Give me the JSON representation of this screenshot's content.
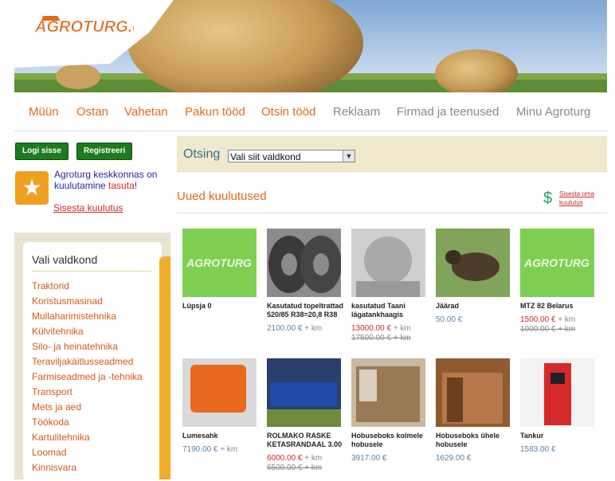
{
  "logo": "AGROTURG.ee",
  "nav": [
    {
      "label": "Müün"
    },
    {
      "label": "Ostan"
    },
    {
      "label": "Vahetan"
    },
    {
      "label": "Pakun tööd"
    },
    {
      "label": "Otsin tööd"
    },
    {
      "label": "Reklaam"
    },
    {
      "label": "Firmad ja teenused"
    },
    {
      "label": "Minu Agroturg"
    }
  ],
  "auth": {
    "login": "Logi sisse",
    "register": "Registreeri"
  },
  "promo": {
    "text": "Agroturg keskkonnas on kuulutamine ",
    "accent": "tasuta",
    "end": "!",
    "link": "Sisesta kuulutus"
  },
  "sidebar": {
    "title": "Vali valdkond",
    "items": [
      "Traktorid",
      "Koristusmasinad",
      "Mullaharimistehnika",
      "Külvitehnika",
      "Silo- ja heinatehnika",
      "Teraviljakäitlusseadmed",
      "Farmiseadmed ja -tehnika",
      "Transport",
      "Mets ja aed",
      "Töökoda",
      "Kartulitehnika",
      "Loomad",
      "Kinnisvara"
    ]
  },
  "search": {
    "label": "Otsing",
    "select": "Vali siit valdkond"
  },
  "listings": {
    "title": "Uued kuulutused",
    "post_link": "Sisesta oma kuulutus",
    "items": [
      {
        "title": "Lüpsja 0",
        "price": "",
        "km": "",
        "old": ""
      },
      {
        "title": "Kasutatud topeltrattad 520/85 R38=20,8 R38",
        "price": "2100.00 €",
        "km": " + km",
        "old": ""
      },
      {
        "title": "kasutatud Taani lägatankhaagis",
        "price": "13000.00 €",
        "km": " + km",
        "old": "17500.00 € + km"
      },
      {
        "title": "Jäärad",
        "price": "50.00 €",
        "km": "",
        "old": ""
      },
      {
        "title": "MTZ 82 Belarus",
        "price": "1500.00 €",
        "km": " + km",
        "old": "1000.00 € + km"
      },
      {
        "title": "Lumesahk",
        "price": "7190.00 €",
        "km": " + km",
        "old": ""
      },
      {
        "title": "ROLMAKO RASKE KETASRANDAAL 3.00",
        "price": "6000.00 €",
        "km": " + km",
        "old": "6500.00 € + km"
      },
      {
        "title": "Hobuseboks kolmele hobusele",
        "price": "3917.00 €",
        "km": "",
        "old": ""
      },
      {
        "title": "Hobuseboks ühele hobusele",
        "price": "1629.00 €",
        "km": "",
        "old": ""
      },
      {
        "title": "Tankur",
        "price": "1583.00 €",
        "km": "",
        "old": ""
      }
    ]
  },
  "colors": {
    "accent": "#e06b1a",
    "green": "#1e7a1e",
    "link": "#c92a2a",
    "search_bg": "#f1e9cd"
  }
}
